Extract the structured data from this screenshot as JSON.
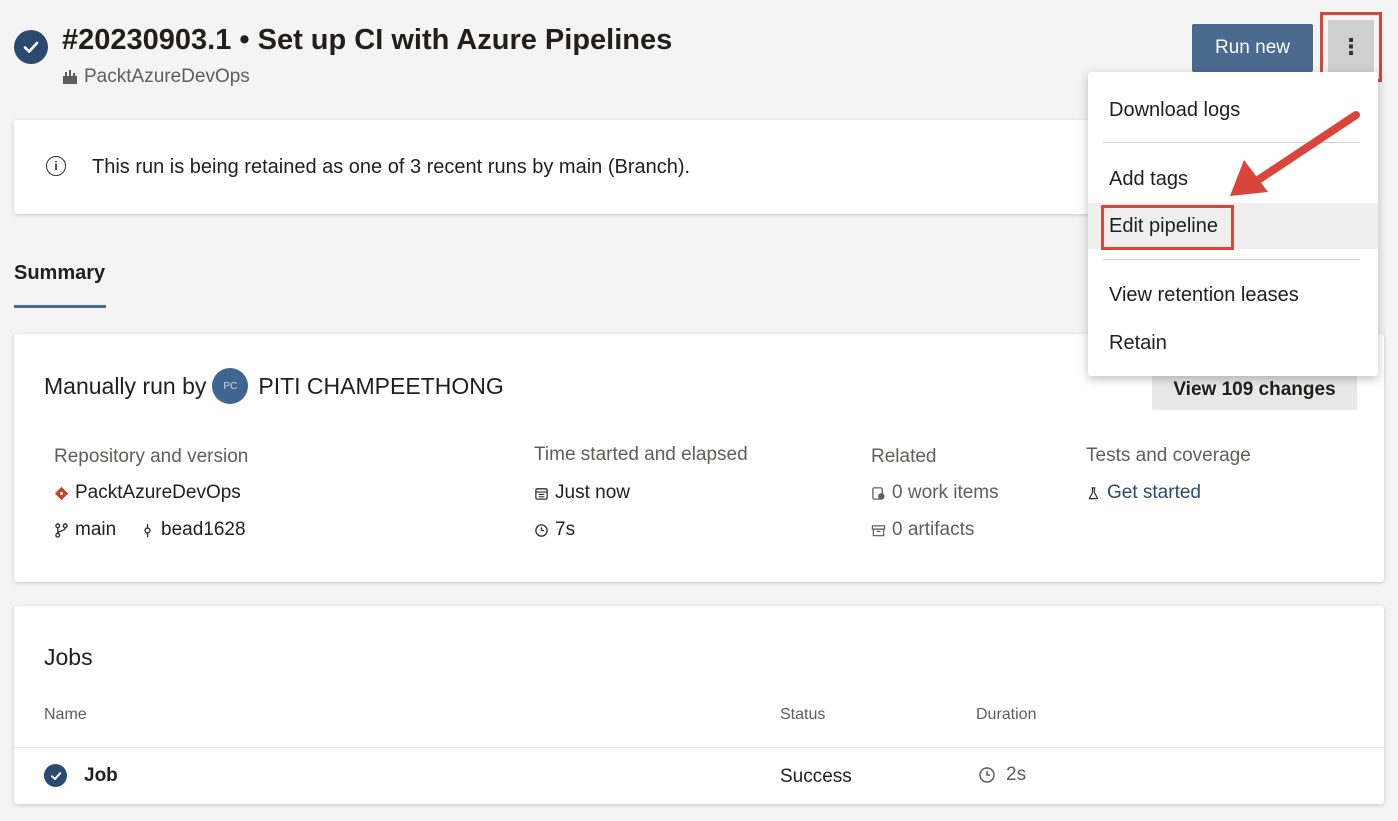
{
  "header": {
    "run_title": "#20230903.1 • Set up CI with Azure Pipelines",
    "project": "PacktAzureDevOps",
    "run_new_label": "Run new",
    "more_label": "⋮"
  },
  "banner": {
    "text": "This run is being retained as one of 3 recent runs by main (Branch)."
  },
  "tabs": [
    {
      "label": "Summary",
      "active": true
    }
  ],
  "summary": {
    "manual_run_prefix": "Manually run by",
    "user_name": "PITI CHAMPEETHONG",
    "avatar_initials": "PC",
    "view_changes_label": "View 109 changes",
    "repository": {
      "header": "Repository and version",
      "repo": "PacktAzureDevOps",
      "branch": "main",
      "commit": "bead1628"
    },
    "time": {
      "header": "Time started and elapsed",
      "started": "Just now",
      "elapsed": "7s"
    },
    "related": {
      "header": "Related",
      "work_items": "0 work items",
      "artifacts": "0 artifacts"
    },
    "tests": {
      "header": "Tests and coverage",
      "link": "Get started"
    }
  },
  "jobs": {
    "title": "Jobs",
    "columns": [
      "Name",
      "Status",
      "Duration"
    ],
    "rows": [
      {
        "name": "Job",
        "status": "Success",
        "duration": "2s"
      }
    ]
  },
  "menu": {
    "items": [
      "Download logs",
      "Add tags",
      "Edit pipeline",
      "View retention leases",
      "Retain"
    ]
  },
  "colors": {
    "accent": "#4a6b8e",
    "status_success": "#2b4a6f",
    "annotation": "#d9453a",
    "repo_icon": "#c9402b"
  },
  "icons": {
    "status": "check-circle-icon",
    "more": "more-vertical-icon",
    "info": "info-icon",
    "repo": "git-repo-icon",
    "branch": "branch-icon",
    "commit": "commit-icon",
    "calendar": "calendar-icon",
    "clock": "clock-icon",
    "work_items": "work-items-icon",
    "artifacts": "artifact-icon",
    "tests": "flask-icon"
  }
}
